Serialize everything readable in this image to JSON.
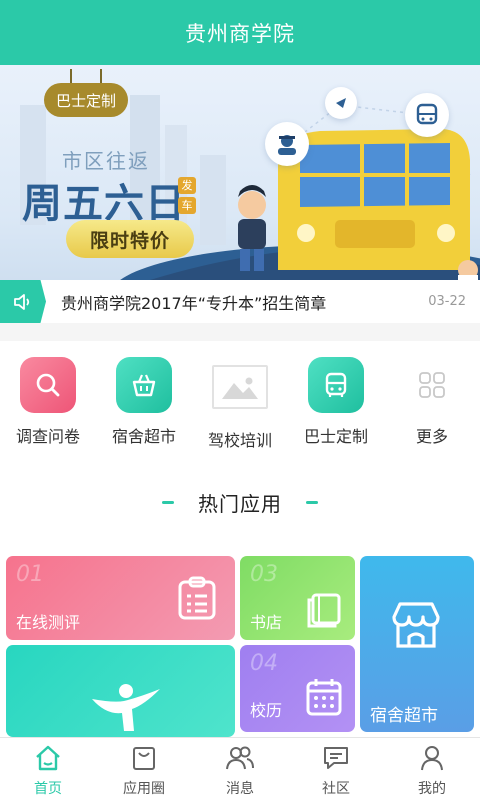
{
  "header": {
    "title": "贵州商学院"
  },
  "banner": {
    "tag": "巴士定制",
    "subtitle": "市区往返",
    "main": "周五六日",
    "badge_chars": [
      "发",
      "车"
    ],
    "promo": "限时特价"
  },
  "notice": {
    "text": "贵州商学院2017年“专升本”招生简章",
    "date": "03-22"
  },
  "quick_icons": [
    {
      "label": "调查问卷",
      "icon": "search-icon",
      "color": "#f26585"
    },
    {
      "label": "宿舍超市",
      "icon": "basket-icon",
      "color": "#2bc9a8"
    },
    {
      "label": "驾校培训",
      "icon": "image-placeholder-icon",
      "color": "#dddddd"
    },
    {
      "label": "巴士定制",
      "icon": "bus-icon",
      "color": "#2bc9a8"
    },
    {
      "label": "更多",
      "icon": "grid-icon",
      "color": "#cccccc"
    }
  ],
  "hot_section": {
    "title": "热门应用"
  },
  "hot_apps": [
    {
      "num": "01",
      "label": "在线测评",
      "icon": "clipboard-icon"
    },
    {
      "num": "03",
      "label": "书店",
      "icon": "book-icon"
    },
    {
      "num": "",
      "label": "宿舍超市",
      "icon": "shop-icon"
    },
    {
      "num": "",
      "label": "",
      "icon": "dancer-icon"
    },
    {
      "num": "04",
      "label": "校历",
      "icon": "calendar-icon"
    }
  ],
  "tabs": [
    {
      "label": "首页",
      "icon": "home-icon",
      "active": true
    },
    {
      "label": "应用圈",
      "icon": "bag-icon",
      "active": false
    },
    {
      "label": "消息",
      "icon": "people-icon",
      "active": false
    },
    {
      "label": "社区",
      "icon": "chat-icon",
      "active": false
    },
    {
      "label": "我的",
      "icon": "user-icon",
      "active": false
    }
  ],
  "colors": {
    "primary": "#2bc9a8",
    "red": "#f26585",
    "green": "#8ee06a",
    "purple": "#a07cf0",
    "blue": "#4aa8e6"
  }
}
